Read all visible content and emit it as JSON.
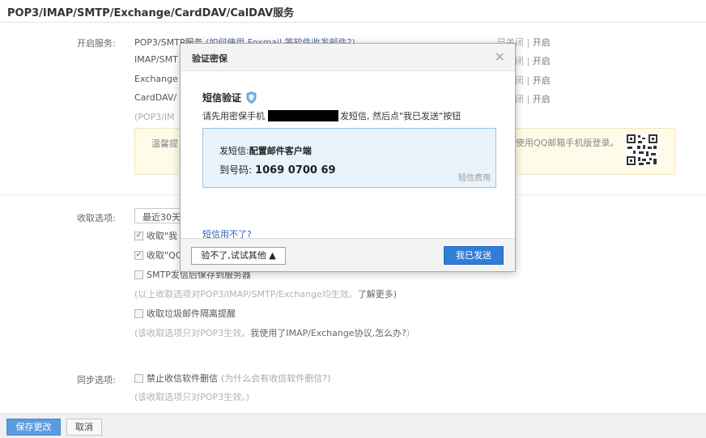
{
  "section_title": "POP3/IMAP/SMTP/Exchange/CardDAV/CalDAV服务",
  "enable": {
    "label": "开启服务:",
    "rows": [
      {
        "text": "POP3/SMTP服务",
        "link": "(如何使用 Foxmail 等软件收发邮件?)",
        "status": "已关闭",
        "sep": "|",
        "action": "开启"
      },
      {
        "text": "IMAP/SMT",
        "status": "已关闭",
        "sep": "|",
        "action": "开启"
      },
      {
        "text": "Exchange",
        "status": "已关闭",
        "sep": "|",
        "action": "开启"
      },
      {
        "text": "CardDAV/",
        "status": "已关闭",
        "sep": "|",
        "action": "开启"
      }
    ],
    "note": "(POP3/IM"
  },
  "tip": {
    "left": "温馨提",
    "right": "使用QQ邮箱手机版登录。"
  },
  "receive": {
    "label": "收取选项:",
    "select_value": "最近30天",
    "options": [
      {
        "checked": true,
        "text": "收取\"我"
      },
      {
        "checked": true,
        "text": "收取\"QQ"
      },
      {
        "checked": false,
        "text": "SMTP发信后保存到服务器"
      }
    ],
    "note1": "(以上收取选项对POP3/IMAP/SMTP/Exchange均生效。",
    "note1_link": "了解更多)",
    "spam": {
      "checked": false,
      "text": "收取垃圾邮件隔离提醒"
    },
    "note2": "(该收取选项只对POP3生效。",
    "note2_link": "我使用了IMAP/Exchange协议,怎么办?",
    "note2_end": ")"
  },
  "sync": {
    "label": "同步选项:",
    "option": {
      "checked": false,
      "text": "禁止收信软件删信",
      "hint": "(为什么会有收信软件删信?)"
    },
    "note": "(该收取选项只对POP3生效。)"
  },
  "buttons": {
    "save": "保存更改",
    "cancel": "取消"
  },
  "modal": {
    "title": "验证密保",
    "close": "×",
    "sms_title": "短信验证",
    "instr_pre": "请先用密保手机",
    "instr_post": "发短信, 然后点\"我已发送\"按钮",
    "sms_label": "发短信:",
    "sms_content": "配置邮件客户端",
    "to_label": "到号码:",
    "to_number": "1069 0700 69",
    "fee": "短信费用",
    "fail_link": "短信用不了?",
    "other_button": "验不了,试试其他 ▲",
    "sent_button": "我已发送"
  }
}
